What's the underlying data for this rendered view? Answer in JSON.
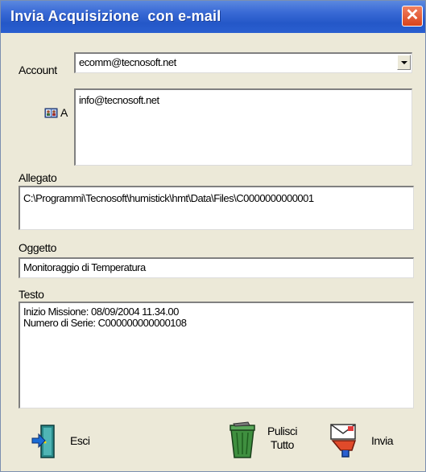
{
  "window": {
    "title": "Invia Acquisizione  con e-mail",
    "close_icon": "close-icon"
  },
  "account": {
    "label": "Account",
    "value": "ecomm@tecnosoft.net"
  },
  "to": {
    "label": "A",
    "value": "info@tecnosoft.net",
    "icon": "address-book-icon"
  },
  "attachment": {
    "label": "Allegato",
    "value": "C:\\Programmi\\Tecnosoft\\humistick\\hmt\\Data\\Files\\C0000000000001"
  },
  "subject": {
    "label": "Oggetto",
    "value": "Monitoraggio di Temperatura"
  },
  "body": {
    "label": "Testo",
    "value": "Inizio Missione: 08/09/2004 11.34.00\nNumero di Serie: C000000000000108"
  },
  "buttons": {
    "exit": {
      "label": "Esci",
      "icon": "exit-door-icon"
    },
    "clear": {
      "label": "Pulisci\nTutto",
      "icon": "trash-bin-icon"
    },
    "send": {
      "label": "Invia",
      "icon": "send-mail-icon"
    }
  },
  "colors": {
    "titlebar": "#2457c8",
    "close": "#d9431c",
    "dialog": "#ece9d8"
  }
}
